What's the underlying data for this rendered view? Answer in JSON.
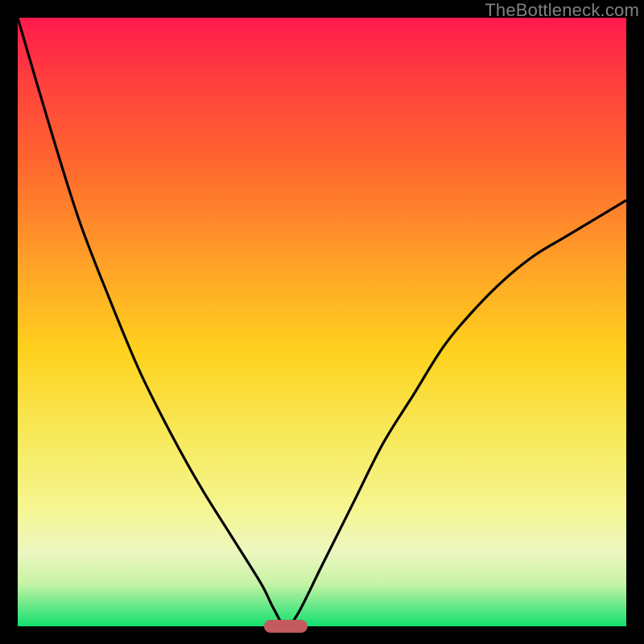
{
  "watermark": "TheBottleneck.com",
  "chart_data": {
    "type": "line",
    "title": "",
    "subtitle": "",
    "xlabel": "",
    "ylabel": "",
    "xlim": [
      0,
      100
    ],
    "ylim": [
      0,
      100
    ],
    "grid": false,
    "legend": false,
    "series": [
      {
        "name": "curve",
        "x": [
          0,
          5,
          10,
          15,
          20,
          25,
          30,
          35,
          40,
          42,
          44,
          46,
          50,
          55,
          60,
          65,
          70,
          75,
          80,
          85,
          90,
          95,
          100
        ],
        "y": [
          100,
          83,
          67,
          54,
          42,
          32,
          23,
          15,
          7,
          3,
          0,
          2,
          10,
          20,
          30,
          38,
          46,
          52,
          57,
          61,
          64,
          67,
          70
        ]
      }
    ],
    "annotations": [
      {
        "name": "floor-marker",
        "x": 44,
        "y": 0,
        "color": "#c25a5f"
      }
    ]
  },
  "colors": {
    "frame": "#000000",
    "watermark": "#808080",
    "gradient_top": "#ff1a4d",
    "gradient_bottom": "#11e06f",
    "curve": "#000000",
    "marker": "#c25a5f"
  }
}
